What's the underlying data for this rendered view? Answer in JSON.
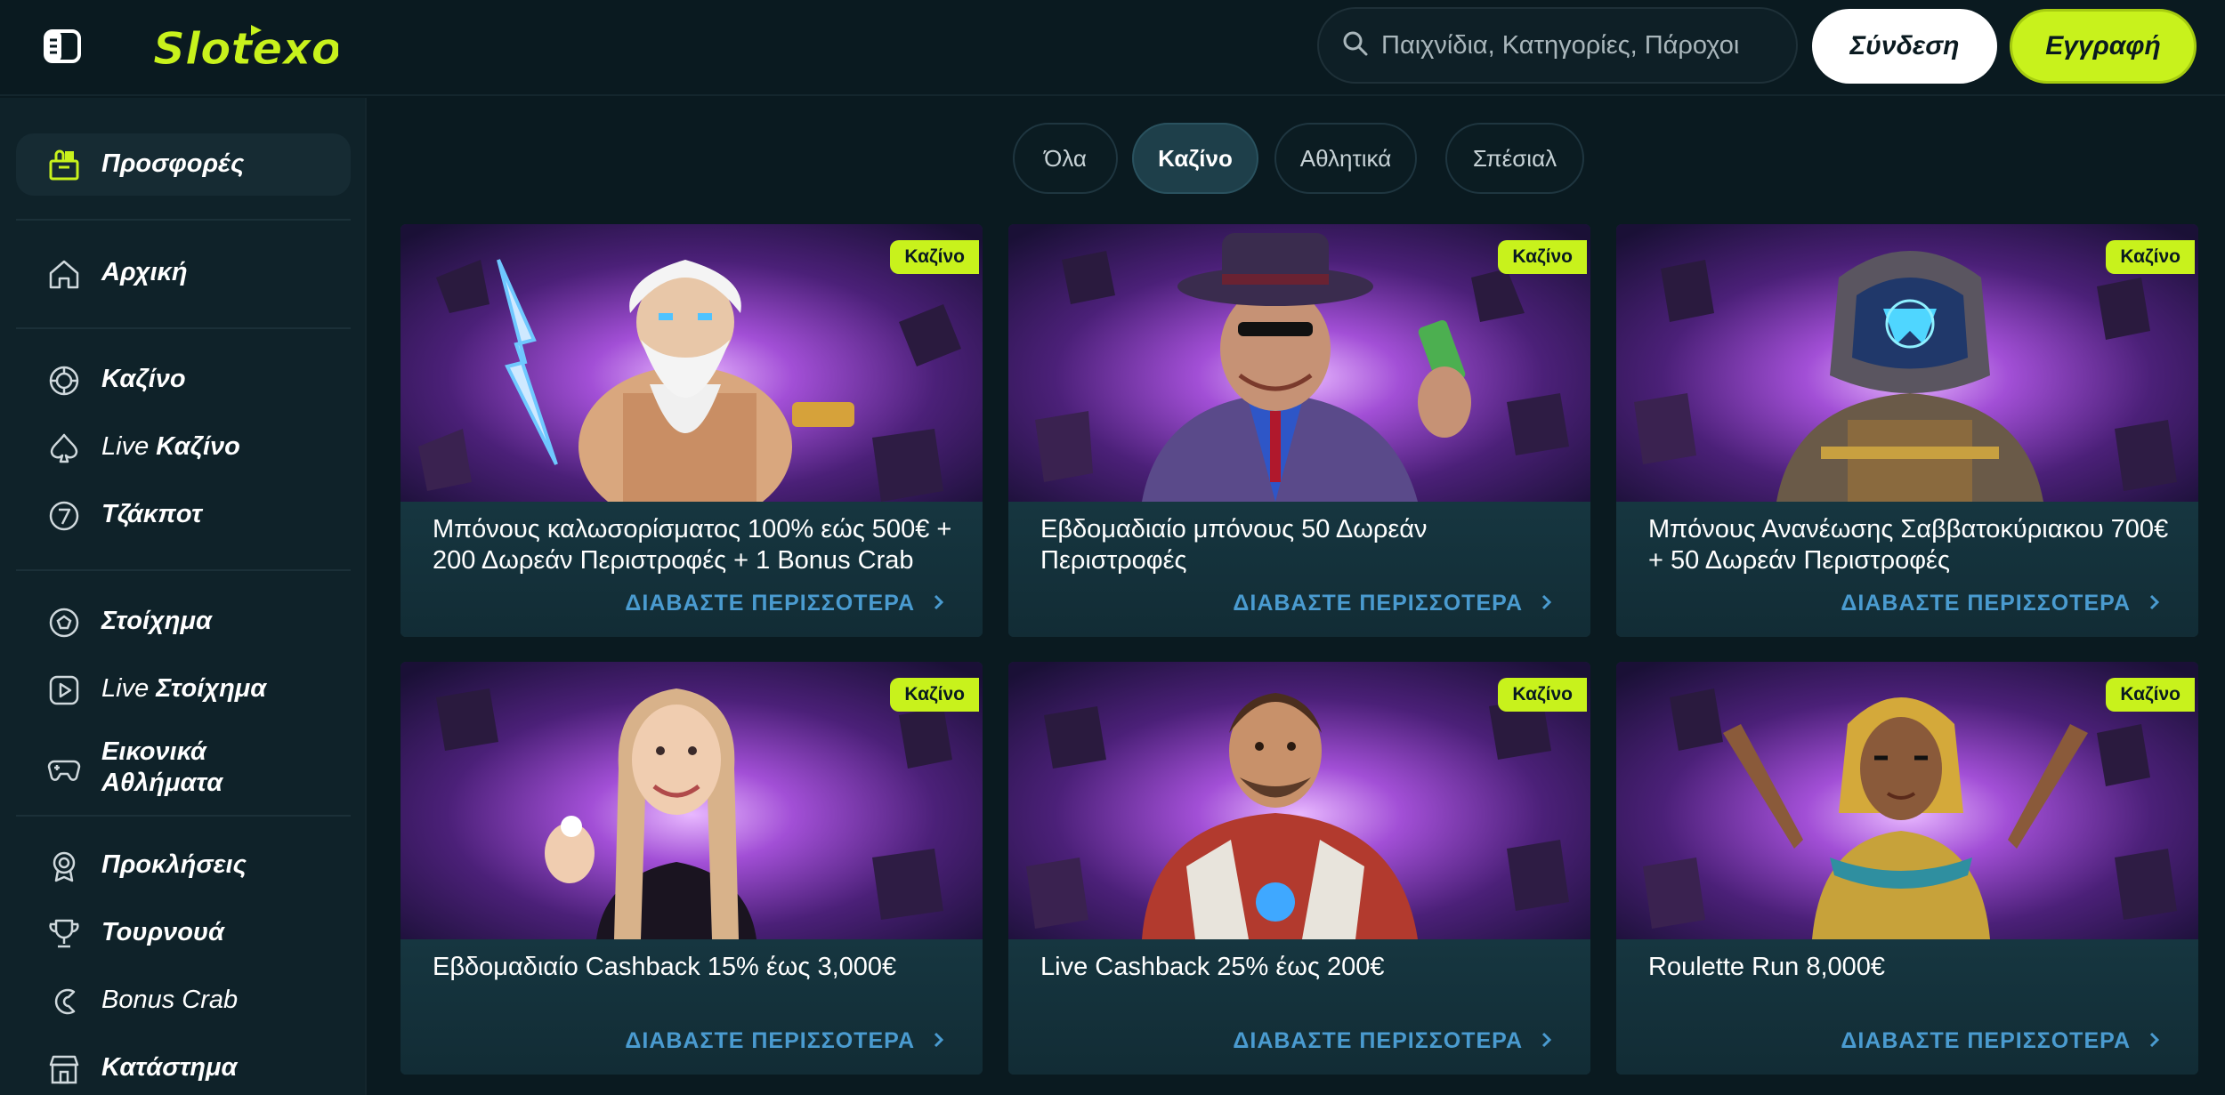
{
  "header": {
    "logo_text": "Slotexo",
    "search_placeholder": "Παιχνίδια, Κατηγορίες, Πάροχοι",
    "login_label": "Σύνδεση",
    "register_label": "Εγγραφή"
  },
  "sidebar": {
    "items": [
      {
        "label": "Προσφορές",
        "icon": "gift-shop-icon"
      },
      {
        "label": "Αρχική",
        "icon": "home-icon"
      },
      {
        "label": "Καζίνο",
        "icon": "casino-chip-icon"
      },
      {
        "prefix": "Live ",
        "label": "Καζίνο",
        "icon": "spade-icon"
      },
      {
        "label": "Τζάκποτ",
        "icon": "seven-icon"
      },
      {
        "label": "Στοίχημα",
        "icon": "football-icon"
      },
      {
        "prefix": "Live ",
        "label": "Στοίχημα",
        "icon": "play-screen-icon"
      },
      {
        "label": "Εικονικά Αθλήματα",
        "icon": "gamepad-icon"
      },
      {
        "label": "Προκλήσεις",
        "icon": "medal-icon"
      },
      {
        "label": "Τουρνουά",
        "icon": "trophy-icon"
      },
      {
        "label": "Bonus Crab",
        "icon": "crab-claw-icon"
      },
      {
        "label": "Κατάστημα",
        "icon": "store-icon"
      }
    ]
  },
  "tabs": [
    {
      "label": "Όλα",
      "active": false
    },
    {
      "label": "Καζίνο",
      "active": true
    },
    {
      "label": "Αθλητικά",
      "active": false
    },
    {
      "label": "Σπέσιαλ",
      "active": false
    }
  ],
  "read_more": "ΔΙΑΒΑΣΤΕ ΠΕΡΙΣΣΟΤΕΡΑ",
  "cards": [
    {
      "badge": "Καζίνο",
      "title": "Μπόνους καλωσορίσματος 100% εώς 500€ + 200 Δωρεάν Περιστροφές + 1 Bonus Crab",
      "art": "zeus"
    },
    {
      "badge": "Καζίνο",
      "title": "Εβδομαδιαίο μπόνους 50 Δωρεάν Περιστροφές",
      "art": "gangster"
    },
    {
      "badge": "Καζίνο",
      "title": "Μπόνους Ανανέωσης Σαββατοκύριακου 700€ + 50 Δωρεάν Περιστροφές",
      "art": "robot"
    },
    {
      "badge": "Καζίνο",
      "title": "Εβδομαδιαίο Cashback 15% έως 3,000€",
      "art": "dealer"
    },
    {
      "badge": "Καζίνο",
      "title": "Live Cashback 25% έως 200€",
      "art": "space-soldier"
    },
    {
      "badge": "Καζίνο",
      "title": "Roulette Run 8,000€",
      "art": "pharaoh"
    }
  ],
  "colors": {
    "background": "#0a1a20",
    "sidebar": "#0f2229",
    "accent": "#c8f21c",
    "link": "#4a9bd0"
  }
}
